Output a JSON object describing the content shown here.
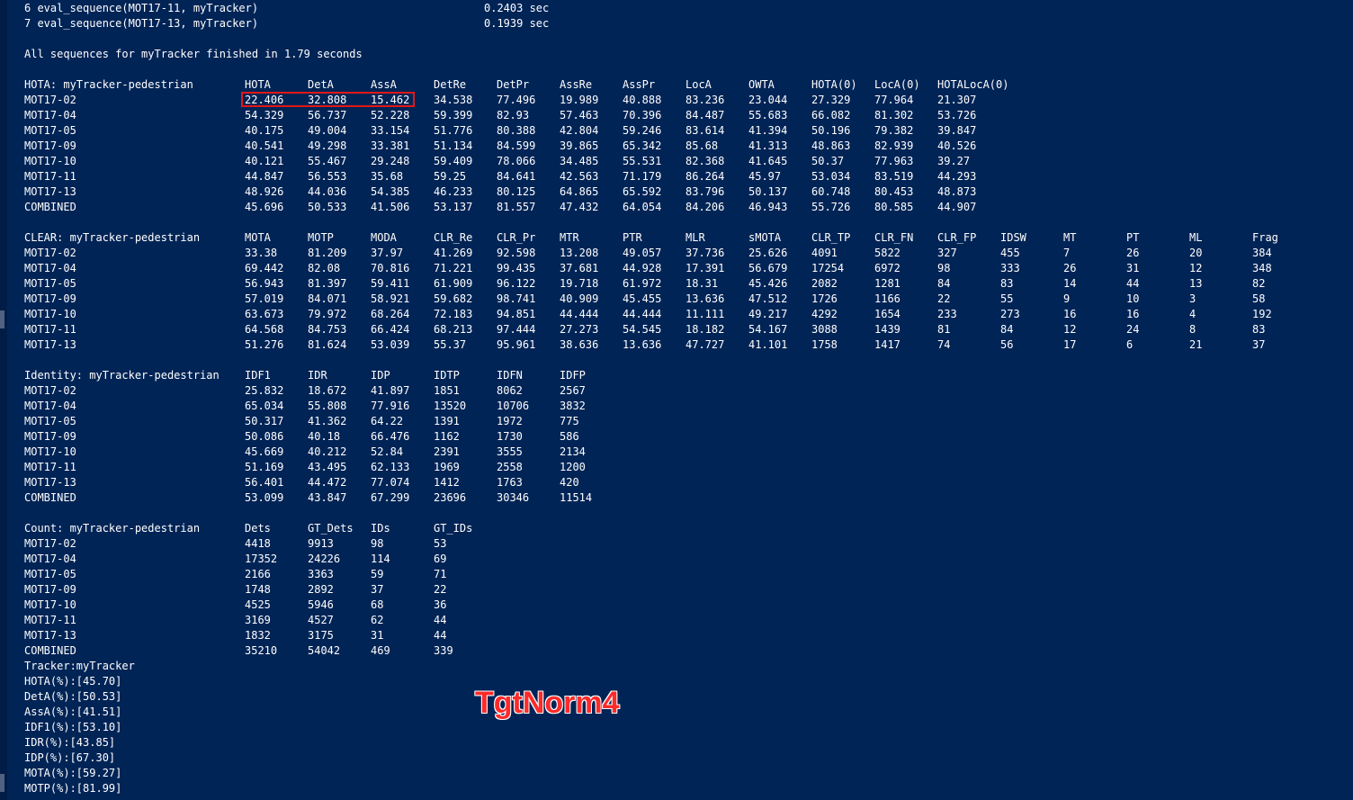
{
  "log_lines": [
    {
      "label": "6 eval_sequence(MOT17-11, myTracker)",
      "value": "0.2403 sec"
    },
    {
      "label": "7 eval_sequence(MOT17-13, myTracker)",
      "value": "0.1939 sec"
    }
  ],
  "finished_line": "All sequences for myTracker finished in 1.79 seconds",
  "hota": {
    "title": "HOTA: myTracker-pedestrian",
    "headers": [
      "HOTA",
      "DetA",
      "AssA",
      "DetRe",
      "DetPr",
      "AssRe",
      "AssPr",
      "LocA",
      "OWTA",
      "HOTA(0)",
      "LocA(0)",
      "HOTALocA(0)"
    ],
    "rows": [
      {
        "name": "MOT17-02",
        "values": [
          "22.406",
          "32.808",
          "15.462",
          "34.538",
          "77.496",
          "19.989",
          "40.888",
          "83.236",
          "23.044",
          "27.329",
          "77.964",
          "21.307"
        ]
      },
      {
        "name": "MOT17-04",
        "values": [
          "54.329",
          "56.737",
          "52.228",
          "59.399",
          "82.93",
          "57.463",
          "70.396",
          "84.487",
          "55.683",
          "66.082",
          "81.302",
          "53.726"
        ]
      },
      {
        "name": "MOT17-05",
        "values": [
          "40.175",
          "49.004",
          "33.154",
          "51.776",
          "80.388",
          "42.804",
          "59.246",
          "83.614",
          "41.394",
          "50.196",
          "79.382",
          "39.847"
        ]
      },
      {
        "name": "MOT17-09",
        "values": [
          "40.541",
          "49.298",
          "33.381",
          "51.134",
          "84.599",
          "39.865",
          "65.342",
          "85.68",
          "41.313",
          "48.863",
          "82.939",
          "40.526"
        ]
      },
      {
        "name": "MOT17-10",
        "values": [
          "40.121",
          "55.467",
          "29.248",
          "59.409",
          "78.066",
          "34.485",
          "55.531",
          "82.368",
          "41.645",
          "50.37",
          "77.963",
          "39.27"
        ]
      },
      {
        "name": "MOT17-11",
        "values": [
          "44.847",
          "56.553",
          "35.68",
          "59.25",
          "84.641",
          "42.563",
          "71.179",
          "86.264",
          "45.97",
          "53.034",
          "83.519",
          "44.293"
        ]
      },
      {
        "name": "MOT17-13",
        "values": [
          "48.926",
          "44.036",
          "54.385",
          "46.233",
          "80.125",
          "64.865",
          "65.592",
          "83.796",
          "50.137",
          "60.748",
          "80.453",
          "48.873"
        ]
      },
      {
        "name": "COMBINED",
        "values": [
          "45.696",
          "50.533",
          "41.506",
          "53.137",
          "81.557",
          "47.432",
          "64.054",
          "84.206",
          "46.943",
          "55.726",
          "80.585",
          "44.907"
        ]
      }
    ]
  },
  "clear": {
    "title": "CLEAR: myTracker-pedestrian",
    "headers": [
      "MOTA",
      "MOTP",
      "MODA",
      "CLR_Re",
      "CLR_Pr",
      "MTR",
      "PTR",
      "MLR",
      "sMOTA",
      "CLR_TP",
      "CLR_FN",
      "CLR_FP",
      "IDSW",
      "MT",
      "PT",
      "ML",
      "Frag"
    ],
    "rows": [
      {
        "name": "MOT17-02",
        "values": [
          "33.38",
          "81.209",
          "37.97",
          "41.269",
          "92.598",
          "13.208",
          "49.057",
          "37.736",
          "25.626",
          "4091",
          "5822",
          "327",
          "455",
          "7",
          "26",
          "20",
          "384"
        ]
      },
      {
        "name": "MOT17-04",
        "values": [
          "69.442",
          "82.08",
          "70.816",
          "71.221",
          "99.435",
          "37.681",
          "44.928",
          "17.391",
          "56.679",
          "17254",
          "6972",
          "98",
          "333",
          "26",
          "31",
          "12",
          "348"
        ]
      },
      {
        "name": "MOT17-05",
        "values": [
          "56.943",
          "81.397",
          "59.411",
          "61.909",
          "96.122",
          "19.718",
          "61.972",
          "18.31",
          "45.426",
          "2082",
          "1281",
          "84",
          "83",
          "14",
          "44",
          "13",
          "82"
        ]
      },
      {
        "name": "MOT17-09",
        "values": [
          "57.019",
          "84.071",
          "58.921",
          "59.682",
          "98.741",
          "40.909",
          "45.455",
          "13.636",
          "47.512",
          "1726",
          "1166",
          "22",
          "55",
          "9",
          "10",
          "3",
          "58"
        ]
      },
      {
        "name": "MOT17-10",
        "values": [
          "63.673",
          "79.972",
          "68.264",
          "72.183",
          "94.851",
          "44.444",
          "44.444",
          "11.111",
          "49.217",
          "4292",
          "1654",
          "233",
          "273",
          "16",
          "16",
          "4",
          "192"
        ]
      },
      {
        "name": "MOT17-11",
        "values": [
          "64.568",
          "84.753",
          "66.424",
          "68.213",
          "97.444",
          "27.273",
          "54.545",
          "18.182",
          "54.167",
          "3088",
          "1439",
          "81",
          "84",
          "12",
          "24",
          "8",
          "83"
        ]
      },
      {
        "name": "MOT17-13",
        "values": [
          "51.276",
          "81.624",
          "53.039",
          "55.37",
          "95.961",
          "38.636",
          "13.636",
          "47.727",
          "41.101",
          "1758",
          "1417",
          "74",
          "56",
          "17",
          "6",
          "21",
          "37"
        ]
      }
    ]
  },
  "identity": {
    "title": "Identity: myTracker-pedestrian",
    "headers": [
      "IDF1",
      "IDR",
      "IDP",
      "IDTP",
      "IDFN",
      "IDFP"
    ],
    "rows": [
      {
        "name": "MOT17-02",
        "values": [
          "25.832",
          "18.672",
          "41.897",
          "1851",
          "8062",
          "2567"
        ]
      },
      {
        "name": "MOT17-04",
        "values": [
          "65.034",
          "55.808",
          "77.916",
          "13520",
          "10706",
          "3832"
        ]
      },
      {
        "name": "MOT17-05",
        "values": [
          "50.317",
          "41.362",
          "64.22",
          "1391",
          "1972",
          "775"
        ]
      },
      {
        "name": "MOT17-09",
        "values": [
          "50.086",
          "40.18",
          "66.476",
          "1162",
          "1730",
          "586"
        ]
      },
      {
        "name": "MOT17-10",
        "values": [
          "45.669",
          "40.212",
          "52.84",
          "2391",
          "3555",
          "2134"
        ]
      },
      {
        "name": "MOT17-11",
        "values": [
          "51.169",
          "43.495",
          "62.133",
          "1969",
          "2558",
          "1200"
        ]
      },
      {
        "name": "MOT17-13",
        "values": [
          "56.401",
          "44.472",
          "77.074",
          "1412",
          "1763",
          "420"
        ]
      },
      {
        "name": "COMBINED",
        "values": [
          "53.099",
          "43.847",
          "67.299",
          "23696",
          "30346",
          "11514"
        ]
      }
    ]
  },
  "count": {
    "title": "Count: myTracker-pedestrian",
    "headers": [
      "Dets",
      "GT_Dets",
      "IDs",
      "GT_IDs"
    ],
    "rows": [
      {
        "name": "MOT17-02",
        "values": [
          "4418",
          "9913",
          "98",
          "53"
        ]
      },
      {
        "name": "MOT17-04",
        "values": [
          "17352",
          "24226",
          "114",
          "69"
        ]
      },
      {
        "name": "MOT17-05",
        "values": [
          "2166",
          "3363",
          "59",
          "71"
        ]
      },
      {
        "name": "MOT17-09",
        "values": [
          "1748",
          "2892",
          "37",
          "22"
        ]
      },
      {
        "name": "MOT17-10",
        "values": [
          "4525",
          "5946",
          "68",
          "36"
        ]
      },
      {
        "name": "MOT17-11",
        "values": [
          "3169",
          "4527",
          "62",
          "44"
        ]
      },
      {
        "name": "MOT17-13",
        "values": [
          "1832",
          "3175",
          "31",
          "44"
        ]
      },
      {
        "name": "COMBINED",
        "values": [
          "35210",
          "54042",
          "469",
          "339"
        ]
      }
    ]
  },
  "summary_lines": [
    "Tracker:myTracker",
    "HOTA(%):[45.70]",
    "DetA(%):[50.53]",
    "AssA(%):[41.51]",
    "IDF1(%):[53.10]",
    "IDR(%):[43.85]",
    "IDP(%):[67.30]",
    "MOTA(%):[59.27]",
    "MOTP(%):[81.99]"
  ],
  "watermark": "TgtNorm4",
  "colors": {
    "background": "#012456",
    "text": "#ffffff",
    "highlight": "#e01818",
    "watermark": "#ff2a2a"
  }
}
